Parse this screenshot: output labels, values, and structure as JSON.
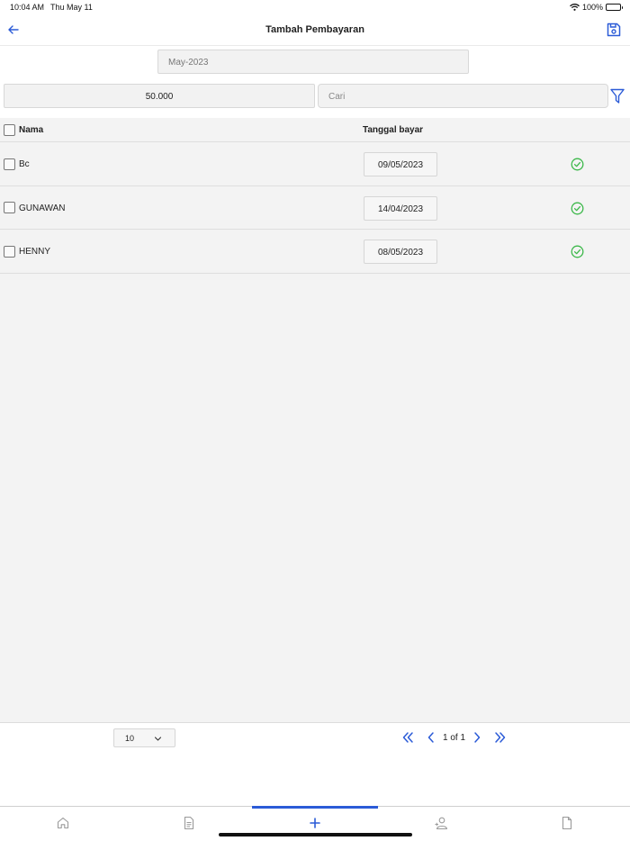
{
  "status_bar": {
    "time": "10:04 AM",
    "date": "Thu May 11",
    "battery": "100%"
  },
  "header": {
    "title": "Tambah Pembayaran",
    "back_icon": "arrow-left-icon",
    "save_icon": "floppy-disk-icon"
  },
  "filters": {
    "month": "May-2023",
    "amount": "50.000",
    "search_placeholder": "Cari",
    "filter_icon": "funnel-icon"
  },
  "table": {
    "columns": {
      "name": "Nama",
      "date": "Tanggal bayar"
    },
    "rows": [
      {
        "name": "Bc",
        "date": "09/05/2023",
        "status_icon": "check-circle-icon"
      },
      {
        "name": "GUNAWAN",
        "date": "14/04/2023",
        "status_icon": "check-circle-icon"
      },
      {
        "name": "HENNY",
        "date": "08/05/2023",
        "status_icon": "check-circle-icon"
      }
    ]
  },
  "pagination": {
    "page_size": "10",
    "page_info": "1 of 1"
  },
  "tabs": [
    {
      "icon": "home-icon"
    },
    {
      "icon": "document-list-icon"
    },
    {
      "icon": "plus-icon",
      "active": true
    },
    {
      "icon": "user-icon"
    },
    {
      "icon": "file-icon"
    }
  ],
  "colors": {
    "accent": "#2b5bd7",
    "success": "#3cb84a"
  }
}
